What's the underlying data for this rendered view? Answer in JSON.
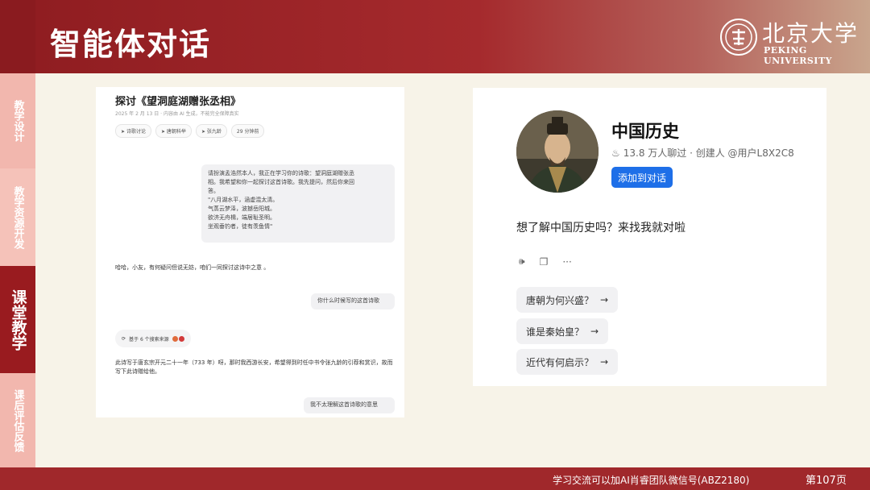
{
  "header": {
    "title": "智能体对话",
    "university_cn": "北京大学",
    "university_en": "PEKING UNIVERSITY"
  },
  "sidebar": {
    "items": [
      {
        "label": "教学设计",
        "active": false
      },
      {
        "label": "教学资源开发",
        "active": false
      },
      {
        "label": "课堂教学",
        "active": true
      },
      {
        "label": "课后评估反馈",
        "active": false
      }
    ]
  },
  "left_chat": {
    "title": "探讨《望洞庭湖赠张丞相》",
    "meta": "2025 年 2 月 13 日 · 内容由 AI 生成，不能完全保障真实",
    "tags": [
      "诗歌讨论",
      "唐朝科举",
      "张九龄",
      "29 分钟前"
    ],
    "user_message_1": [
      "请扮演孟浩然本人，我正在学习你的诗歌：望洞庭湖赠张丞",
      "相。我希望和你一起探讨这首诗歌。我先提问，然后你来回",
      "答。",
      "\"八月湖水平，涵虚混太清。",
      "气蒸云梦泽，波撼岳阳城。",
      "欲济无舟楫，端居耻圣明。",
      "坐观垂钓者，徒有羡鱼情\""
    ],
    "bot_reply_1": "哈哈，小友，有何疑问但说无妨，咱们一同探讨这诗中之意 。",
    "user_message_2": "你什么时候写的这首诗歌",
    "search_pill": "基于 6 个搜索来源",
    "bot_reply_2": "此诗写于唐玄宗开元二十一年（733 年）呀，那时我西游长安，希望得到时任中书令张九龄的引荐和赏识，故而写下此诗赠给他。",
    "user_message_3": "我不太理解这首诗歌的意思"
  },
  "right_bot": {
    "name": "中国历史",
    "stats": "13.8 万人聊过 · 创建人 @用户L8X2C8",
    "add_button": "添加到对话",
    "greeting": "想了解中国历史吗？来找我就对啦",
    "suggestions": [
      "唐朝为何兴盛？",
      "谁是秦始皇？",
      "近代有何启示？"
    ],
    "icons": [
      "speaker-icon",
      "copy-icon",
      "more-icon",
      "fire-icon",
      "arrow-right-icon"
    ]
  },
  "footer": {
    "text": "学习交流可以加AI肖睿团队微信号(ABZ2180)",
    "page": "第107页"
  },
  "colors": {
    "brand_red": "#991b1f",
    "sidebar_inactive": "#f2b7ae",
    "button_blue": "#1e6fe8",
    "background": "#f7f3e8"
  }
}
